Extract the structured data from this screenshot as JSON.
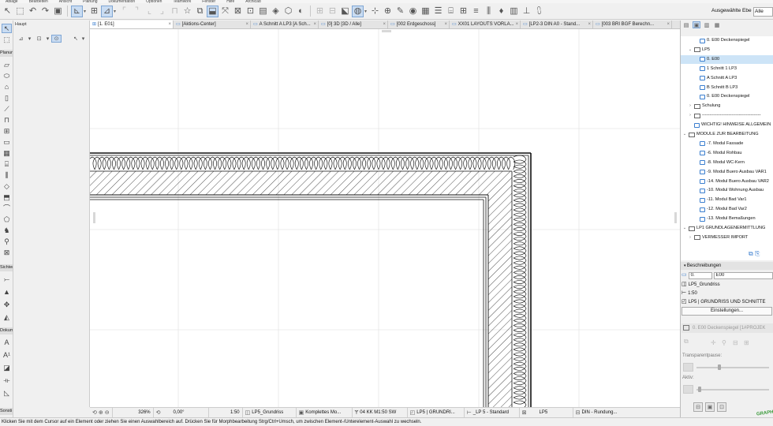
{
  "menubar": [
    "Ablage",
    "Bearbeiten",
    "Ansicht",
    "Planung",
    "Dokumentation",
    "Optionen",
    "Teamwork",
    "Fenster",
    "Hilfe",
    "Archicad"
  ],
  "toolbar": {
    "layer_label": "Ausgewählte Ebe",
    "layer_value": "Alle Ebe"
  },
  "infobox": {
    "label": "Haupt"
  },
  "toolbox": {
    "categories": [
      "Planung",
      "Sichten",
      "Dokum",
      "Sonsti"
    ]
  },
  "tabs": [
    {
      "label": "[1. E01]",
      "active": true
    },
    {
      "label": "[Aktions-Center]"
    },
    {
      "label": "A Schnitt A LP3 [A Sch..."
    },
    {
      "label": "[0] 3D [3D / Alle]"
    },
    {
      "label": "[002 Erdgeschoss]"
    },
    {
      "label": "XX01 LAYOUTS VORLA..."
    },
    {
      "label": "[LP2-3 DIN A0 - Stand..."
    },
    {
      "label": "[003 BRI BGF Berechn..."
    }
  ],
  "view_status": {
    "zoom": "326%",
    "angle": "0,00°",
    "scale": "1:50",
    "layer_combo": "LP5_Grundriss",
    "model_view": "Komplettes Mo...",
    "pen_set": "04 KK M1:50 SW",
    "mvo": "LP5 | GRUNDRI...",
    "dimension": "_LP 5 - Standard",
    "renovation": "LP5",
    "partial": "DIN - Rundung..."
  },
  "message": "Klicken Sie mit dem Cursor auf ein Element oder ziehen Sie einen Auswahlbereich auf. Drücken Sie für Morphbearbeitung Strg/Ctrl+Umsch, um zwischen Element-/Unterelement-Auswahl zu wechseln.",
  "navigator": {
    "tree": [
      {
        "label": "0. E00 Deckenspiegel",
        "kind": "view",
        "indent": 2
      },
      {
        "label": "LP5",
        "kind": "folder",
        "indent": 1,
        "open": true
      },
      {
        "label": "0. E00",
        "kind": "view",
        "indent": 2,
        "selected": true
      },
      {
        "label": "1 Schnitt 1 LP3",
        "kind": "view",
        "indent": 2
      },
      {
        "label": "A Schnitt A LP3",
        "kind": "view",
        "indent": 2
      },
      {
        "label": "B Schnitt B LP3",
        "kind": "view",
        "indent": 2
      },
      {
        "label": "0. E00 Deckenspiegel",
        "kind": "view",
        "indent": 2
      },
      {
        "label": "Schulung",
        "kind": "folder",
        "indent": 1,
        "open": false
      },
      {
        "label": "----------------------------------------",
        "kind": "folder",
        "indent": 1
      },
      {
        "label": "WICHTIG! HINWEISE ALLGEMEIN",
        "kind": "view",
        "indent": 1
      },
      {
        "label": "MODULE ZUR BEARBEITUNG",
        "kind": "folder",
        "indent": 0,
        "open": true
      },
      {
        "label": "-7. Modul Fassade",
        "kind": "view",
        "indent": 2
      },
      {
        "label": "-6. Modul Rohbau",
        "kind": "view",
        "indent": 2
      },
      {
        "label": "-8. Modul WC-Kern",
        "kind": "view",
        "indent": 2
      },
      {
        "label": "-9. Modul Buero Ausbau VAR1",
        "kind": "view",
        "indent": 2
      },
      {
        "label": "-14. Modul Buero Ausbau VAR2",
        "kind": "view",
        "indent": 2
      },
      {
        "label": "-10. Modul Wohnung Ausbau",
        "kind": "view",
        "indent": 2
      },
      {
        "label": "-11. Modul Bad Var1",
        "kind": "view",
        "indent": 2
      },
      {
        "label": "-12. Modul Bad Var2",
        "kind": "view",
        "indent": 2
      },
      {
        "label": "-13. Modul Bemaßungen",
        "kind": "view",
        "indent": 2
      },
      {
        "label": "LP1 GRUNDLAGENERMITTLUNG",
        "kind": "folder",
        "indent": 0,
        "open": true
      },
      {
        "label": "VERMESSER IMPORT",
        "kind": "folder",
        "indent": 1
      }
    ],
    "beschreibungen": "Beschreibungen",
    "id_value": "0.",
    "name_value": "E00",
    "layer_combo": "LP5_Grundriss",
    "scale": "1:50",
    "mvo": "LP5 | GRUNDRISS UND SCHNITTE",
    "settings_button": "Einstellungen...",
    "preview_label": "0. E00 Deckenspiegel [1#PROJEK",
    "transparency_label": "Transparentpause:",
    "active_label": "Aktiv:",
    "logo_text": "GRAPHI"
  }
}
